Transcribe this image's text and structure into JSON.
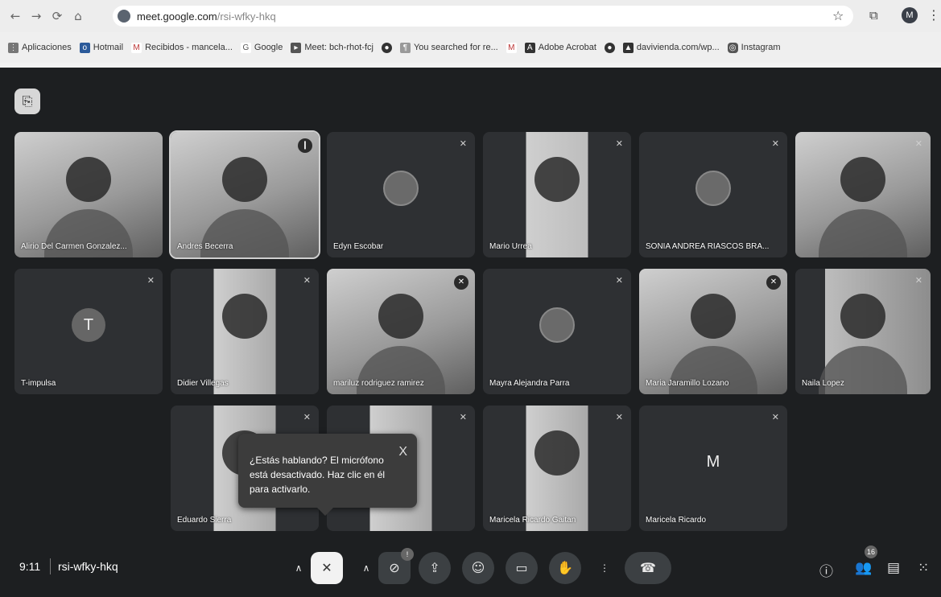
{
  "browser": {
    "url_host": "meet.google.com",
    "url_path": "/rsi-wfky-hkq",
    "profile_initial": "M",
    "bookmarks": [
      {
        "label": "Aplicaciones",
        "icon": "apps-grid-icon"
      },
      {
        "label": "Hotmail",
        "icon": "outlook-icon"
      },
      {
        "label": "Recibidos - mancela...",
        "icon": "gmail-icon"
      },
      {
        "label": "Google",
        "icon": "google-icon"
      },
      {
        "label": "Meet: bch-rhot-fcj",
        "icon": "meet-icon"
      },
      {
        "label": "You searched for re...",
        "icon": "page-icon"
      },
      {
        "label": "Adobe Acrobat",
        "icon": "acrobat-icon"
      },
      {
        "label": "davivienda.com/wp...",
        "icon": "davivienda-icon"
      },
      {
        "label": "Instagram",
        "icon": "instagram-icon"
      }
    ]
  },
  "participants": [
    {
      "name": "Alirio Del Carmen Gonzalez..."
    },
    {
      "name": "Andres Becerra"
    },
    {
      "name": "Edyn Escobar"
    },
    {
      "name": "Mario Urrea"
    },
    {
      "name": "SONIA ANDREA RIASCOS BRA..."
    },
    {
      "name": ""
    },
    {
      "name": "T-impulsa",
      "initial": "T"
    },
    {
      "name": "Didier Villegas"
    },
    {
      "name": "mariluz rodriguez ramirez"
    },
    {
      "name": "Mayra Alejandra Parra"
    },
    {
      "name": "Maria Jaramillo Lozano"
    },
    {
      "name": "Naila Lopez"
    },
    {
      "name": "Eduardo Sierra"
    },
    {
      "name": ""
    },
    {
      "name": "Maricela Ricardo Gaitan"
    },
    {
      "name": "Maricela Ricardo",
      "initial": "M"
    }
  ],
  "tooltip": {
    "text": "¿Estás hablando? El micrófono está desactivado. Haz clic en él para activarlo.",
    "close": "X"
  },
  "meeting": {
    "time": "9:11",
    "code": "rsi-wfky-hkq",
    "participant_count": "16",
    "camera_badge": "!"
  }
}
